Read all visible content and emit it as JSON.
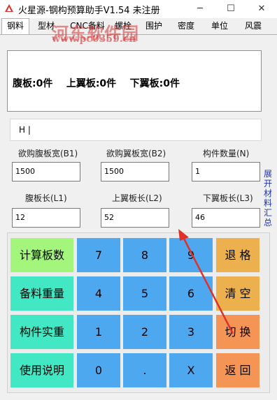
{
  "window": {
    "title": "火星源-钢构预算助手V1.54 未注册",
    "minimize": "─",
    "maximize": "☐",
    "close": "✕"
  },
  "tabs": [
    "钢料",
    "型材",
    "CNC备料",
    "螺栓",
    "围护",
    "密度",
    "单位",
    "风震"
  ],
  "watermark": {
    "text": "河东软件园",
    "url": "www.pc0359.cn"
  },
  "result": {
    "text": "腹板:0件    上翼板:0件    下翼板:0件"
  },
  "input_line": {
    "value": "H   |"
  },
  "fields": {
    "web_width_label": "欲购腹板宽(B1)",
    "web_width_value": "1500",
    "flange_width_label": "欲购翼板宽(B2)",
    "flange_width_value": "1500",
    "count_label": "构件数量(N)",
    "count_value": "1",
    "web_length_label": "腹板长(L1)",
    "web_length_value": "12",
    "upper_length_label": "上翼板长(L2)",
    "upper_length_value": "52",
    "lower_length_label": "下翼板长(L3)",
    "lower_length_value": "46"
  },
  "side_link": "展开材料汇总",
  "keypad": {
    "calc_count": "计算板数",
    "material_weight": "备料重量",
    "actual_weight": "构件实重",
    "help": "使用说明",
    "k7": "7",
    "k8": "8",
    "k9": "9",
    "k4": "4",
    "k5": "5",
    "k6": "6",
    "k1": "1",
    "k2": "2",
    "k3": "3",
    "k0": "0",
    "kdot": ".",
    "kx": "X",
    "backspace": "退 格",
    "clear": "清 空",
    "switch": "切 换",
    "back": "返 回"
  },
  "colors": {
    "green_key": "#a4f57b",
    "cyan_key": "#42e8c4",
    "blue_key": "#4da8ef",
    "orange_key": "#ecb04e",
    "salmon_key": "#f49556",
    "annotation_arrow": "#e0302a",
    "link": "#1a33b8"
  }
}
